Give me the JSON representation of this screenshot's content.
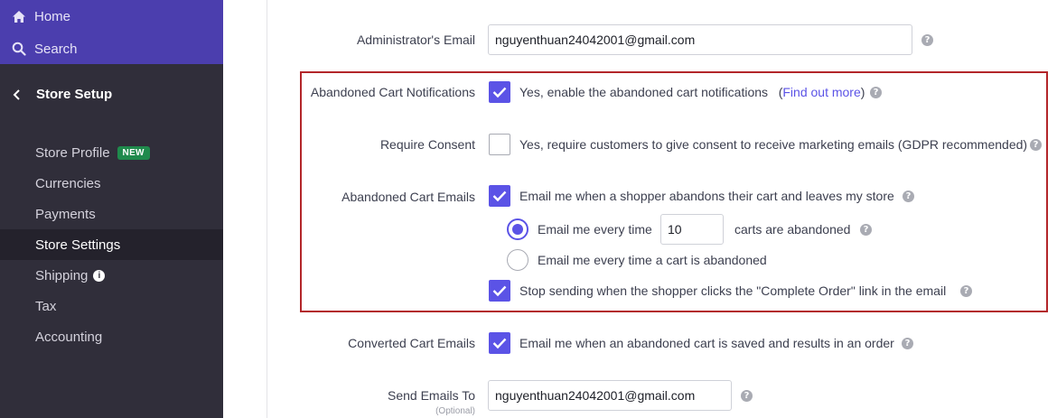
{
  "sidebar": {
    "home_label": "Home",
    "search_label": "Search",
    "section_title": "Store Setup",
    "items": [
      {
        "label": "Store Profile",
        "badge": "NEW"
      },
      {
        "label": "Currencies"
      },
      {
        "label": "Payments"
      },
      {
        "label": "Store Settings",
        "active": true
      },
      {
        "label": "Shipping",
        "info": "i"
      },
      {
        "label": "Tax"
      },
      {
        "label": "Accounting"
      }
    ]
  },
  "form": {
    "admin_email": {
      "label": "Administrator's Email",
      "value": "nguyenthuan24042001@gmail.com"
    },
    "abandoned_notifications": {
      "label": "Abandoned Cart Notifications",
      "checked": true,
      "text": "Yes, enable the abandoned cart notifications",
      "paren_open": "(",
      "link": "Find out more",
      "paren_close": ")"
    },
    "require_consent": {
      "label": "Require Consent",
      "checked": false,
      "text": "Yes, require customers to give consent to receive marketing emails (GDPR recommended)"
    },
    "abandoned_emails": {
      "label": "Abandoned Cart Emails",
      "checked": true,
      "text": "Email me when a shopper abandons their cart and leaves my store",
      "radio_every_prefix": "Email me every time",
      "radio_every_value": "10",
      "radio_every_suffix": "carts are abandoned",
      "radio_each": "Email me every time a cart is abandoned",
      "stop_sending": "Stop sending when the shopper clicks the \"Complete Order\" link in the email"
    },
    "converted_emails": {
      "label": "Converted Cart Emails",
      "checked": true,
      "text": "Email me when an abandoned cart is saved and results in an order"
    },
    "send_emails_to": {
      "label": "Send Emails To",
      "sublabel": "(Optional)",
      "value": "nguyenthuan24042001@gmail.com"
    },
    "help_glyph": "?"
  },
  "colors": {
    "accent": "#5b53e6",
    "highlight_border": "#b3262a",
    "sidebar_bg": "#302e3a",
    "sidebar_top_bg": "#4b3eae"
  }
}
